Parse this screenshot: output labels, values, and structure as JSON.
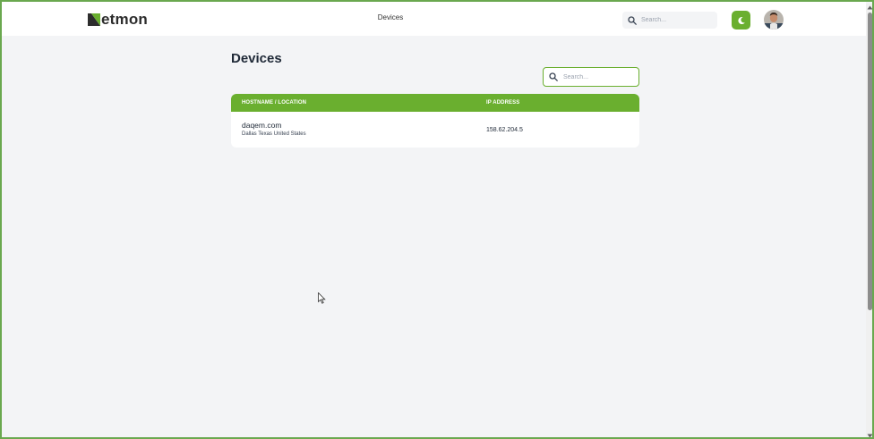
{
  "brand": {
    "logo_text": "etmon",
    "accent_color": "#6aaf2f"
  },
  "header": {
    "nav_link": "Devices",
    "search_placeholder": "Search...",
    "search_icon": "search-icon",
    "theme_toggle_icon": "moon-icon",
    "avatar": "user-avatar"
  },
  "main": {
    "title": "Devices",
    "search_placeholder": "Search...",
    "table": {
      "columns": [
        "HOSTNAME / LOCATION",
        "IP ADDRESS"
      ],
      "rows": [
        {
          "hostname": "daqem.com",
          "location": "Dallas Texas United States",
          "ip": "158.62.204.5"
        }
      ]
    }
  }
}
